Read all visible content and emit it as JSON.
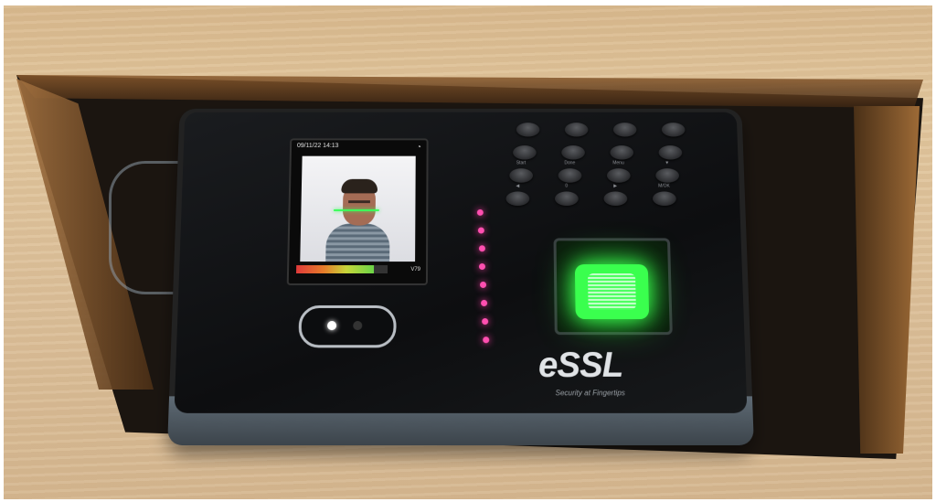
{
  "device": {
    "brand": "eSSL",
    "tagline": "Security at Fingertips",
    "screen": {
      "time": "09/11/22 14:13",
      "corner_text": "V79",
      "wifi_icon": "wifi-icon",
      "quality_fraction": 0.85
    },
    "keypad_labels": [
      "",
      "",
      "",
      "",
      "",
      "",
      "",
      "",
      "Start",
      "Done",
      "Menu",
      "▼",
      "◀",
      "0",
      "▶",
      "M/OK"
    ],
    "led_count": 8,
    "colors": {
      "led": "#ff4fb0",
      "fingerprint": "#3aff4e",
      "wood": "#dcc09a"
    }
  }
}
